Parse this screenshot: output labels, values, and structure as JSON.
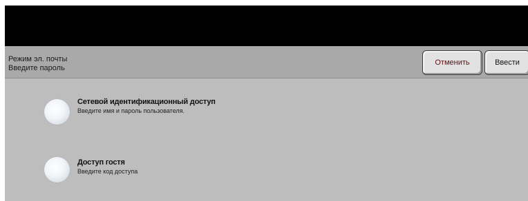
{
  "header": {
    "line1": "Режим эл. почты",
    "line2": "Введите пароль"
  },
  "buttons": {
    "cancel_label": "Отменить",
    "enter_label": "Ввести"
  },
  "options": [
    {
      "title": "Сетевой идентификационный доступ",
      "subtitle": "Введите имя и пароль пользователя."
    },
    {
      "title": "Доступ гостя",
      "subtitle": "Введите код доступа"
    }
  ]
}
